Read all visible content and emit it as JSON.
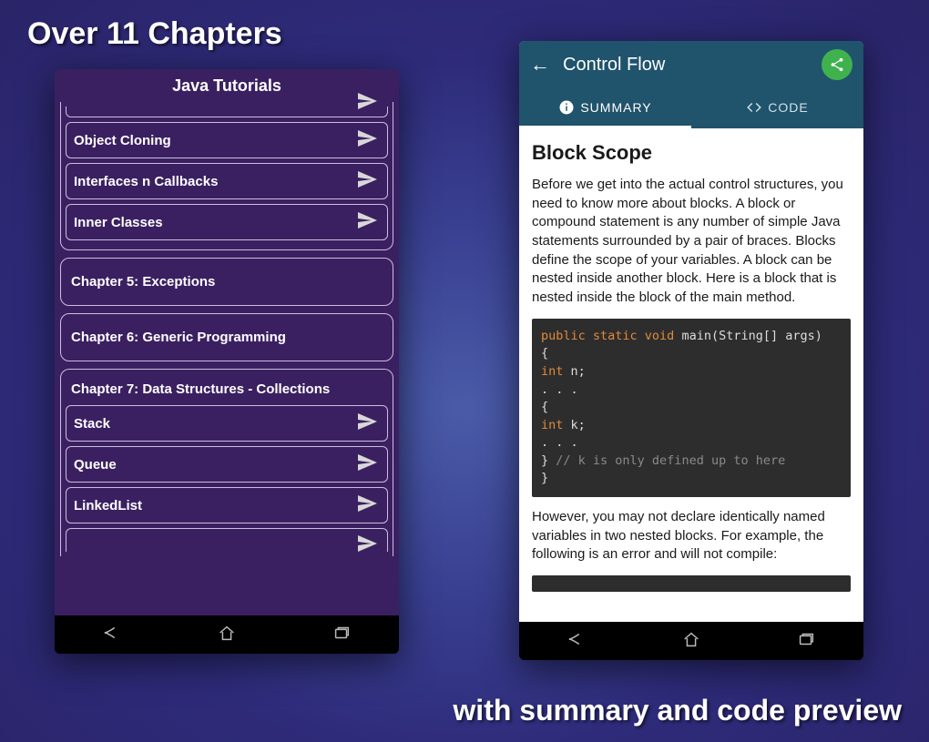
{
  "headline_top": "Over 11 Chapters",
  "headline_bottom": "with summary and code preview",
  "left_phone": {
    "title": "Java Tutorials",
    "group_partial_top_items": [
      "Object Cloning",
      "Interfaces n Callbacks",
      "Inner Classes"
    ],
    "chapter5": "Chapter 5: Exceptions",
    "chapter6": "Chapter 6: Generic Programming",
    "chapter7": "Chapter 7: Data Structures - Collections",
    "chapter7_items": [
      "Stack",
      "Queue",
      "LinkedList"
    ]
  },
  "right_phone": {
    "title": "Control Flow",
    "tabs": {
      "summary": "SUMMARY",
      "code": "CODE"
    },
    "article": {
      "heading": "Block Scope",
      "para1": "Before we get into the actual control structures, you need to know more about blocks. A block or compound statement is any number of simple Java statements surrounded by a pair of braces. Blocks define the scope of your variables. A block can be nested inside another block. Here is a block that is nested inside the block of the main method.",
      "code_lines": {
        "l1_kw": "public static void",
        "l1_rest": " main(String[] args)",
        "l2": "{",
        "l3_kw": "int",
        "l3_rest": " n;",
        "l4": ". . .",
        "l5": "{",
        "l6_kw": "int",
        "l6_rest": " k;",
        "l7": ". . .",
        "l8": "}",
        "l8_cmt": " // k is only defined up to here",
        "l9": "}"
      },
      "para2": "However, you may not declare identically named variables in two nested blocks. For example, the following is an error and will not compile:"
    }
  }
}
